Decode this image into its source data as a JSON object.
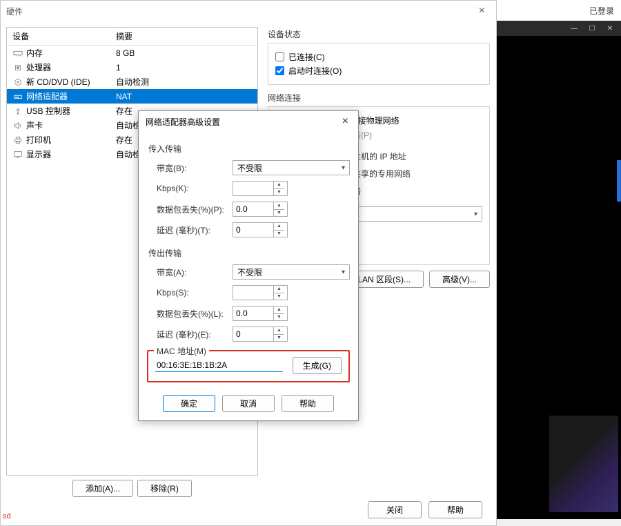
{
  "main": {
    "title": "硬件",
    "logged_in": "已登录",
    "table": {
      "header_device": "设备",
      "header_summary": "摘要",
      "rows": [
        {
          "icon": "memory",
          "device": "内存",
          "summary": "8 GB"
        },
        {
          "icon": "cpu",
          "device": "处理器",
          "summary": "1"
        },
        {
          "icon": "cd",
          "device": "新 CD/DVD (IDE)",
          "summary": "自动检测"
        },
        {
          "icon": "network",
          "device": "网络适配器",
          "summary": "NAT",
          "selected": true
        },
        {
          "icon": "usb",
          "device": "USB 控制器",
          "summary": "存在"
        },
        {
          "icon": "sound",
          "device": "声卡",
          "summary": "自动检测"
        },
        {
          "icon": "printer",
          "device": "打印机",
          "summary": "存在"
        },
        {
          "icon": "display",
          "device": "显示器",
          "summary": "自动检测"
        }
      ]
    },
    "add_btn": "添加(A)...",
    "remove_btn": "移除(R)"
  },
  "right": {
    "device_status_label": "设备状态",
    "connected": "已连接(C)",
    "connect_at_start": "启动时连接(O)",
    "network_conn_label": "网络连接",
    "bridge_mode": "桥接模式(B): 直接连接物理网络",
    "status_p": "状态(P)",
    "host_ip": "享主机的 IP 地址",
    "host_private": "机共享的专用网络",
    "network": "网络",
    "lan_seg_btn": "LAN 区段(S)...",
    "advanced_btn": "高级(V)..."
  },
  "modal": {
    "title": "网络适配器高级设置",
    "incoming_label": "传入传输",
    "outgoing_label": "传出传输",
    "bandwidth_b": "带宽(B):",
    "bandwidth_a": "带宽(A):",
    "unlimited": "不受限",
    "kbps_k": "Kbps(K):",
    "kbps_s": "Kbps(S):",
    "packet_loss_p": "数据包丢失(%)(P):",
    "packet_loss_l": "数据包丢失(%)(L):",
    "latency_t": "延迟 (毫秒)(T):",
    "latency_e": "延迟 (毫秒)(E):",
    "val_loss_in": "0.0",
    "val_lat_in": "0",
    "val_loss_out": "0.0",
    "val_lat_out": "0",
    "mac_label": "MAC 地址(M)",
    "mac_value": "00:16:3E:1B:1B:2A",
    "generate_btn": "生成(G)",
    "ok_btn": "确定",
    "cancel_btn": "取消",
    "help_btn": "帮助"
  },
  "footer": {
    "close_btn": "关闭",
    "help_btn": "帮助"
  },
  "sd": "sd"
}
